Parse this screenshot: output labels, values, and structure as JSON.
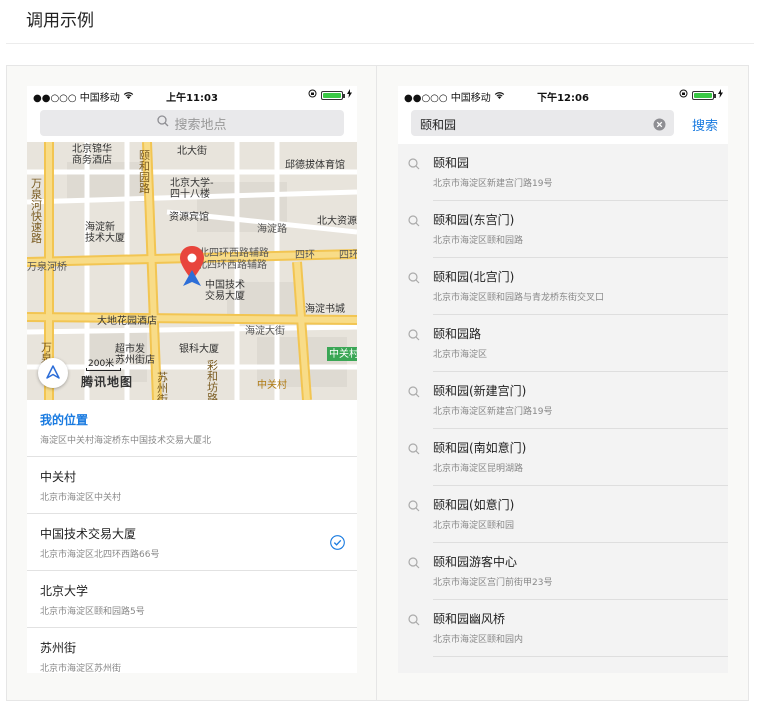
{
  "page": {
    "title": "调用示例"
  },
  "left_phone": {
    "status": {
      "carrier": "●●○○○ 中国移动",
      "time": "上午11:03"
    },
    "search": {
      "placeholder": "搜索地点"
    },
    "map": {
      "labels": {
        "hotel_top": "北京锦华\n商务酒店",
        "yihe_road": "颐和园路",
        "beidajie": "北大街",
        "pku_44": "北京大学-\n四十八楼",
        "qiuci": "邱德拔体育馆",
        "wanquan": "万泉河快速路",
        "resource_hotel": "资源宾馆",
        "beida_resources": "北大资源",
        "haidian_tech": "海淀新\n技术大厦",
        "haidian_road": "海淀路",
        "north4_aux1": "北四环西路辅路",
        "north4_aux2": "北四环西路辅路",
        "north4": "四环",
        "north4b": "四环",
        "wanquanhe_bridge": "万泉河桥",
        "tech_exchange": "中国技术\n交易大厦",
        "haidian_book": "海淀书城",
        "dadi_hotel": "大地花园酒店",
        "haidian_street": "海淀大街",
        "supermarket": "超市发\n苏州街店",
        "yinke": "银科大厦",
        "zhongguancun": "中关村",
        "zhongguancun_mark": "中关村",
        "caifang": "彩和坊路",
        "suzhou": "苏州街",
        "wan": "万泉"
      },
      "scale": "200米",
      "logo": "腾讯地图"
    },
    "places": [
      {
        "name": "我的位置",
        "address": "海淀区中关村海淀桥东中国技术交易大厦北",
        "current": true
      },
      {
        "name": "中关村",
        "address": "北京市海淀区中关村"
      },
      {
        "name": "中国技术交易大厦",
        "address": "北京市海淀区北四环西路66号",
        "selected": true
      },
      {
        "name": "北京大学",
        "address": "北京市海淀区颐和园路5号"
      },
      {
        "name": "苏州街",
        "address": "北京市海淀区苏州街"
      }
    ]
  },
  "right_phone": {
    "status": {
      "carrier": "●●○○○ 中国移动",
      "time": "下午12:06"
    },
    "search": {
      "query": "颐和园",
      "button": "搜索"
    },
    "results": [
      {
        "name": "颐和园",
        "address": "北京市海淀区新建宫门路19号"
      },
      {
        "name": "颐和园(东宫门)",
        "address": "北京市海淀区颐和园路"
      },
      {
        "name": "颐和园(北宫门)",
        "address": "北京市海淀区颐和园路与青龙桥东街交叉口"
      },
      {
        "name": "颐和园路",
        "address": "北京市海淀区"
      },
      {
        "name": "颐和园(新建宫门)",
        "address": "北京市海淀区新建宫门路19号"
      },
      {
        "name": "颐和园(南如意门)",
        "address": "北京市海淀区昆明湖路"
      },
      {
        "name": "颐和园(如意门)",
        "address": "北京市海淀区颐和园"
      },
      {
        "name": "颐和园游客中心",
        "address": "北京市海淀区宫门前街甲23号"
      },
      {
        "name": "颐和园幽风桥",
        "address": "北京市海淀区颐和园内"
      }
    ]
  },
  "colors": {
    "accent": "#1a7be0",
    "road_major": "#f6d36b",
    "map_bg": "#e8e4dc",
    "pin": "#e8453c"
  }
}
